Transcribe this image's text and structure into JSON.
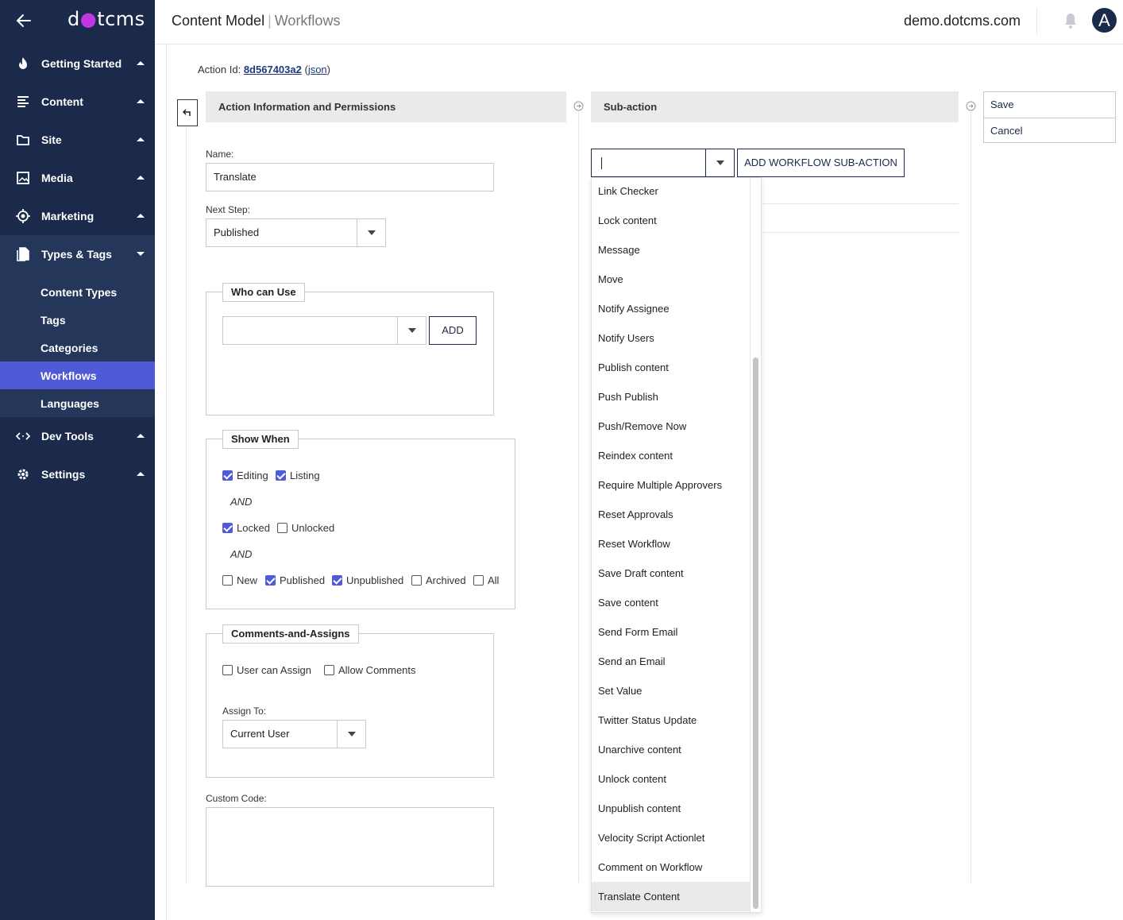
{
  "sidebar": {
    "logo": {
      "pre": "d",
      "mid": "●",
      "post": "tcms"
    },
    "nav": [
      {
        "label": "Getting Started"
      },
      {
        "label": "Content"
      },
      {
        "label": "Site"
      },
      {
        "label": "Media"
      },
      {
        "label": "Marketing"
      },
      {
        "label": "Types & Tags"
      }
    ],
    "sub": [
      {
        "label": "Content Types"
      },
      {
        "label": "Tags"
      },
      {
        "label": "Categories"
      },
      {
        "label": "Workflows"
      },
      {
        "label": "Languages"
      }
    ],
    "nav_bottom": [
      {
        "label": "Dev Tools"
      },
      {
        "label": "Settings"
      }
    ]
  },
  "header": {
    "crumb_parent": "Content Model",
    "crumb_sep": "|",
    "crumb_current": "Workflows",
    "site": "demo.dotcms.com",
    "avatar": "A"
  },
  "action": {
    "label": "Action Id:",
    "id": "8d567403a2",
    "json_open": "(",
    "json": "json",
    "json_close": ")"
  },
  "info": {
    "title": "Action Information and Permissions",
    "name_label": "Name:",
    "name_value": "Translate",
    "next_step_label": "Next Step:",
    "next_step_value": "Published",
    "who_can_use": "Who can Use",
    "add_button": "ADD",
    "show_when": "Show When",
    "editing": "Editing",
    "listing": "Listing",
    "and": "AND",
    "locked": "Locked",
    "unlocked": "Unlocked",
    "new": "New",
    "published": "Published",
    "unpublished": "Unpublished",
    "archived": "Archived",
    "all": "All",
    "comments_assigns": "Comments-and-Assigns",
    "user_can_assign": "User can Assign",
    "allow_comments": "Allow Comments",
    "assign_to_label": "Assign To:",
    "assign_to_value": "Current User",
    "custom_code_label": "Custom Code:"
  },
  "subaction": {
    "title": "Sub-action",
    "add_button": "ADD WORKFLOW SUB-ACTION",
    "options": [
      "Link Checker",
      "Lock content",
      "Message",
      "Move",
      "Notify Assignee",
      "Notify Users",
      "Publish content",
      "Push Publish",
      "Push/Remove Now",
      "Reindex content",
      "Require Multiple Approvers",
      "Reset Approvals",
      "Reset Workflow",
      "Save Draft content",
      "Save content",
      "Send Form Email",
      "Send an Email",
      "Set Value",
      "Twitter Status Update",
      "Unarchive content",
      "Unlock content",
      "Unpublish content",
      "Velocity Script Actionlet",
      "Comment on Workflow",
      "Translate Content"
    ]
  },
  "actions": {
    "save": "Save",
    "cancel": "Cancel"
  },
  "colors": {
    "sidebar_bg": "#1b2a4a",
    "active_item": "#4f5ad7",
    "checkbox_on": "#4f5ad7"
  }
}
